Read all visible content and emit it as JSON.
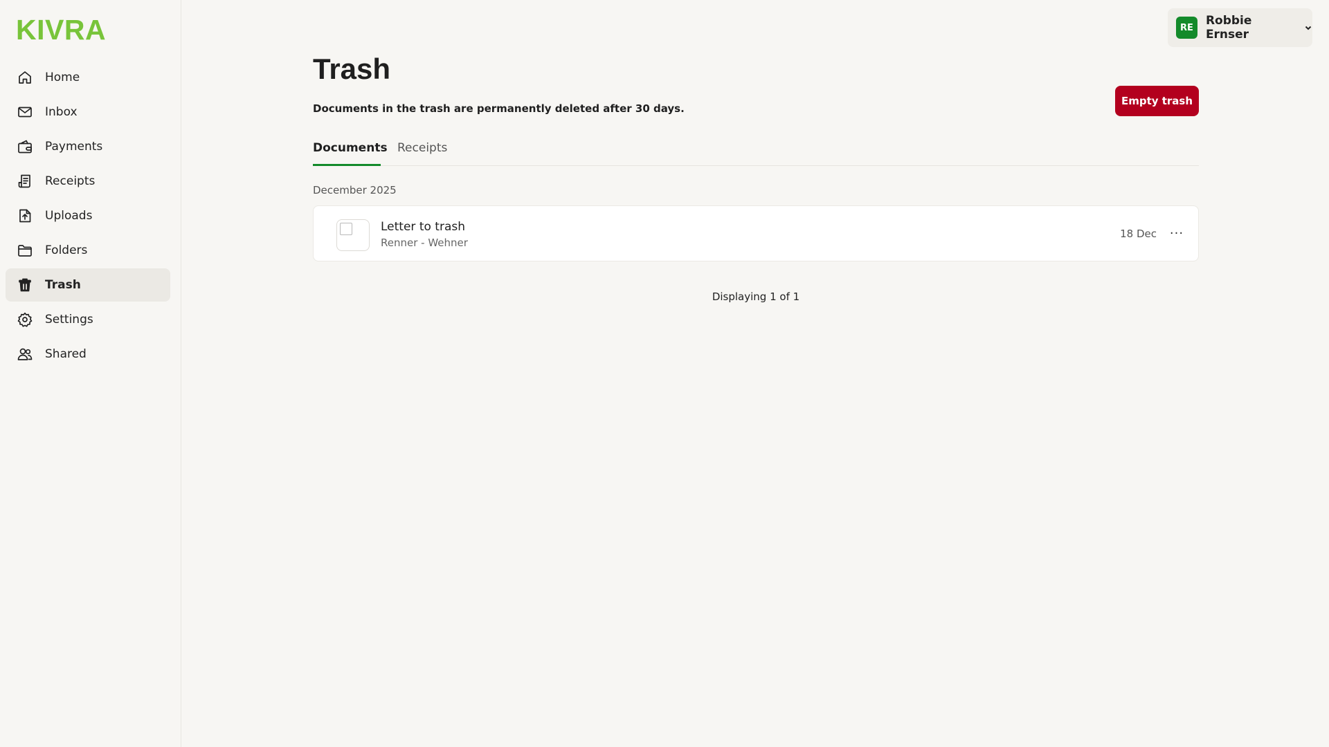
{
  "brand": {
    "logo_text": "KIVRA",
    "logo_color": "#78c43a"
  },
  "sidebar": {
    "items": [
      {
        "label": "Home",
        "icon": "home-icon"
      },
      {
        "label": "Inbox",
        "icon": "mail-icon"
      },
      {
        "label": "Payments",
        "icon": "wallet-icon"
      },
      {
        "label": "Receipts",
        "icon": "receipt-icon"
      },
      {
        "label": "Uploads",
        "icon": "upload-icon"
      },
      {
        "label": "Folders",
        "icon": "folder-icon"
      },
      {
        "label": "Trash",
        "icon": "trash-icon",
        "active": true
      },
      {
        "label": "Settings",
        "icon": "gear-icon"
      },
      {
        "label": "Shared",
        "icon": "users-icon"
      }
    ]
  },
  "user": {
    "initials": "RE",
    "name": "Robbie Ernser",
    "avatar_color": "#138a2a"
  },
  "page": {
    "title": "Trash",
    "subtitle": "Documents in the trash are permanently deleted after 30 days.",
    "empty_button": "Empty trash",
    "danger_color": "#b3001e"
  },
  "tabs": [
    {
      "label": "Documents",
      "active": true
    },
    {
      "label": "Receipts",
      "active": false
    }
  ],
  "groups": [
    {
      "label": "December 2025",
      "documents": [
        {
          "title": "Letter to trash",
          "sender": "Renner - Wehner",
          "date": "18 Dec"
        }
      ]
    }
  ],
  "pagination": {
    "text": "Displaying 1 of 1"
  },
  "more_icon_glyph": "···"
}
